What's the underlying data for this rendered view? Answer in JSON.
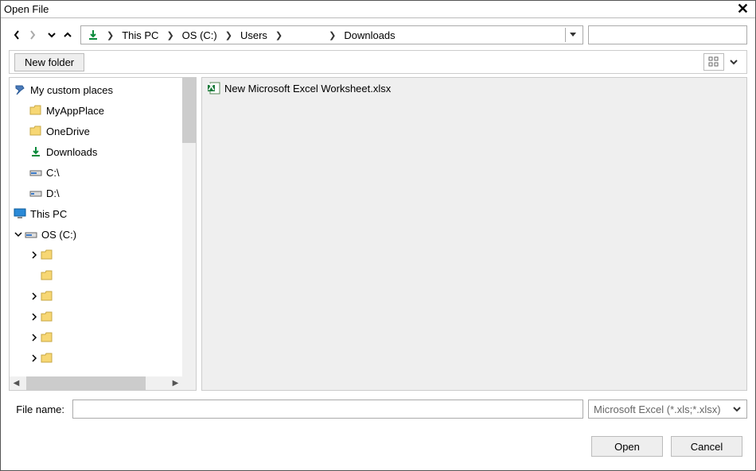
{
  "title": "Open File",
  "nav": {
    "back_enabled": true,
    "forward_enabled": false
  },
  "breadcrumb": [
    "This PC",
    "OS (C:)",
    "Users",
    "",
    "Downloads"
  ],
  "toolbar": {
    "new_folder": "New folder"
  },
  "sidebar": {
    "places_header": "My custom places",
    "places": [
      {
        "label": "MyAppPlace",
        "icon": "folder"
      },
      {
        "label": "OneDrive",
        "icon": "folder"
      },
      {
        "label": "Downloads",
        "icon": "download"
      },
      {
        "label": "C:\\",
        "icon": "drive"
      },
      {
        "label": "D:\\",
        "icon": "drive"
      }
    ],
    "this_pc": "This PC",
    "osc": "OS (C:)",
    "children": [
      {
        "label": "",
        "expandable": true
      },
      {
        "label": "",
        "expandable": false
      },
      {
        "label": "",
        "expandable": true
      },
      {
        "label": "",
        "expandable": true
      },
      {
        "label": "",
        "expandable": true
      },
      {
        "label": "",
        "expandable": true
      }
    ]
  },
  "files": [
    {
      "name": "New Microsoft Excel Worksheet.xlsx",
      "type": "excel"
    }
  ],
  "bottom": {
    "file_name_label": "File name:",
    "file_name_value": "",
    "filter": "Microsoft Excel (*.xls;*.xlsx)"
  },
  "actions": {
    "open": "Open",
    "cancel": "Cancel"
  }
}
